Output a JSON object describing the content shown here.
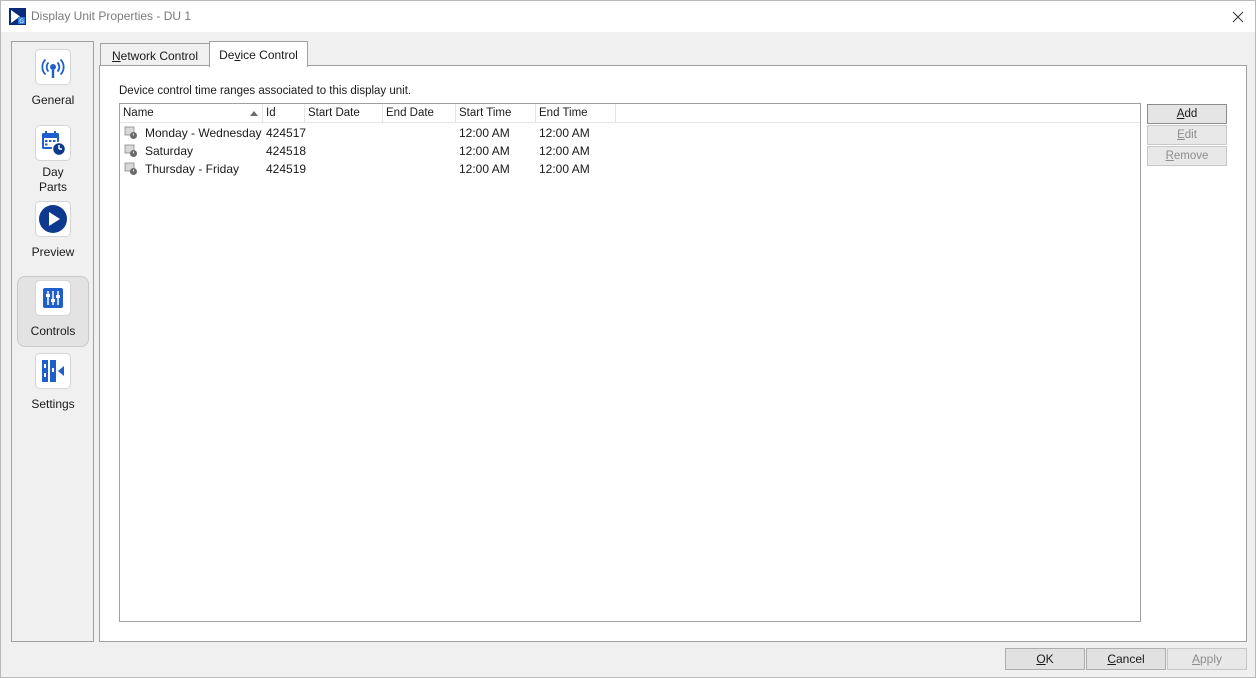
{
  "window": {
    "title": "Display Unit Properties - DU 1",
    "close_icon": "close-icon"
  },
  "nav": {
    "items": [
      {
        "label": "General",
        "icon": "broadcast-icon"
      },
      {
        "label": "Day\nParts",
        "icon": "calendar-clock-icon"
      },
      {
        "label": "Preview",
        "icon": "play-icon"
      },
      {
        "label": "Controls",
        "icon": "sliders-icon",
        "selected": true
      },
      {
        "label": "Settings",
        "icon": "settings-panel-icon"
      }
    ]
  },
  "tabs": [
    {
      "label": "Network Control",
      "accel": "N",
      "rest": "etwork Control"
    },
    {
      "label": "Device Control",
      "pre": "De",
      "accel": "v",
      "rest": "ice Control",
      "active": true
    }
  ],
  "panel": {
    "description": "Device control time ranges associated to this display unit.",
    "columns": [
      "Name",
      "Id",
      "Start Date",
      "End Date",
      "Start Time",
      "End Time"
    ],
    "rows": [
      {
        "name": "Monday - Wednesday",
        "id": "424517",
        "start_date": "",
        "end_date": "",
        "start_time": "12:00 AM",
        "end_time": "12:00 AM"
      },
      {
        "name": "Saturday",
        "id": "424518",
        "start_date": "",
        "end_date": "",
        "start_time": "12:00 AM",
        "end_time": "12:00 AM"
      },
      {
        "name": "Thursday - Friday",
        "id": "424519",
        "start_date": "",
        "end_date": "",
        "start_time": "12:00 AM",
        "end_time": "12:00 AM"
      }
    ]
  },
  "side_buttons": {
    "add": {
      "accel": "A",
      "rest": "dd"
    },
    "edit": {
      "accel": "E",
      "rest": "dit"
    },
    "remove": {
      "accel": "R",
      "rest": "emove"
    }
  },
  "bottom_buttons": {
    "ok": {
      "accel": "O",
      "rest": "K"
    },
    "cancel": {
      "accel": "C",
      "rest": "ancel"
    },
    "apply": {
      "accel": "A",
      "rest": "pply"
    }
  },
  "colors": {
    "accent": "#1f5fc9",
    "dark_accent": "#0d3a8f"
  }
}
